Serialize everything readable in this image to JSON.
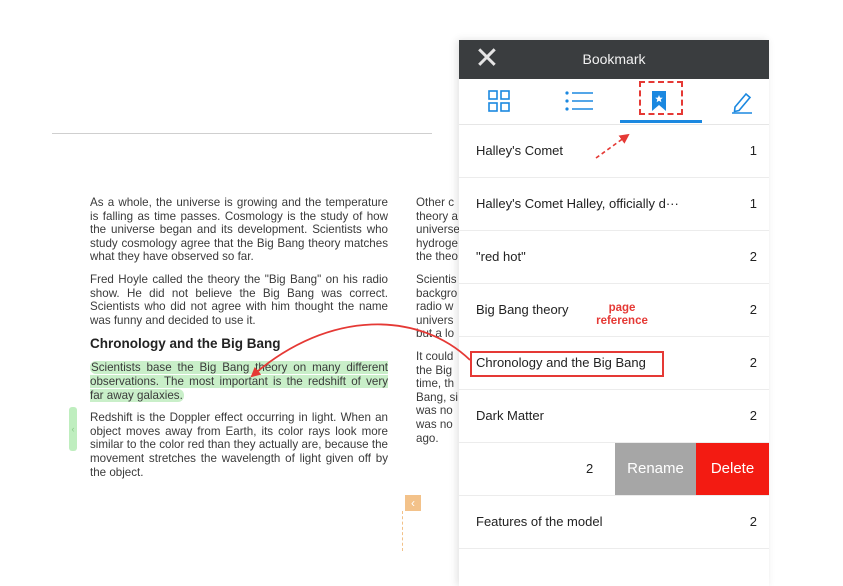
{
  "reader": {
    "left_column": {
      "p1": "As a whole, the universe is growing and the temperature is falling as time passes. Cosmology is the study of how the universe began and its development. Scientists who study cosmology agree that the Big Bang theory matches what they have observed so far.",
      "p2": "Fred Hoyle called the theory the \"Big Bang\" on his radio show. He did not believe the Big Bang was correct. Scientists who did not agree with him thought the name was funny and decided to use it.",
      "heading": "Chronology and the Big Bang",
      "highlighted": "Scientists base the Big Bang theory on many different observations. The most important is the redshift of very far away galaxies.",
      "p4": "Redshift is the Doppler effect occurring in light. When an object moves away from Earth, its color rays look more similar to the color red than they actually are, because the movement stretches the wavelength of light given off by the object."
    },
    "right_column": {
      "p1": [
        "Other c",
        "theory a",
        "universe",
        "hydroge",
        "the theo"
      ],
      "p2": [
        "Scientis",
        "backgro",
        "radio w",
        "univers",
        "but a lo"
      ],
      "p3": [
        "It could",
        "the Big",
        "time, th",
        "Bang, si",
        "was no",
        "was no",
        "ago."
      ]
    }
  },
  "panel": {
    "title": "Bookmark",
    "tabs": [
      {
        "icon": "grid-icon"
      },
      {
        "icon": "list-icon"
      },
      {
        "icon": "bookmark-icon",
        "active": true
      },
      {
        "icon": "pencil-icon"
      }
    ],
    "bookmarks": [
      {
        "label": "Halley's Comet",
        "page": "1"
      },
      {
        "label": "Halley's Comet Halley, officially d···",
        "page": "1"
      },
      {
        "label": "\"red hot\"",
        "page": "2"
      },
      {
        "label": "Big Bang theory",
        "page": "2"
      },
      {
        "label": "Chronology and the Big Bang",
        "page": "2"
      },
      {
        "label": "Dark Matter",
        "page": "2"
      }
    ],
    "swiped_row": {
      "page": "2",
      "rename_label": "Rename",
      "delete_label": "Delete"
    },
    "last_bookmark": {
      "label": "Features of the model",
      "page": "2"
    }
  },
  "annotation": {
    "line1": "page",
    "line2": "reference"
  },
  "colors": {
    "header_bg": "#3a3d3f",
    "accent": "#1b88e0",
    "annotation_red": "#e53935",
    "delete": "#f31b12",
    "rename": "#a6a6a6",
    "highlight": "#c9efc9"
  }
}
